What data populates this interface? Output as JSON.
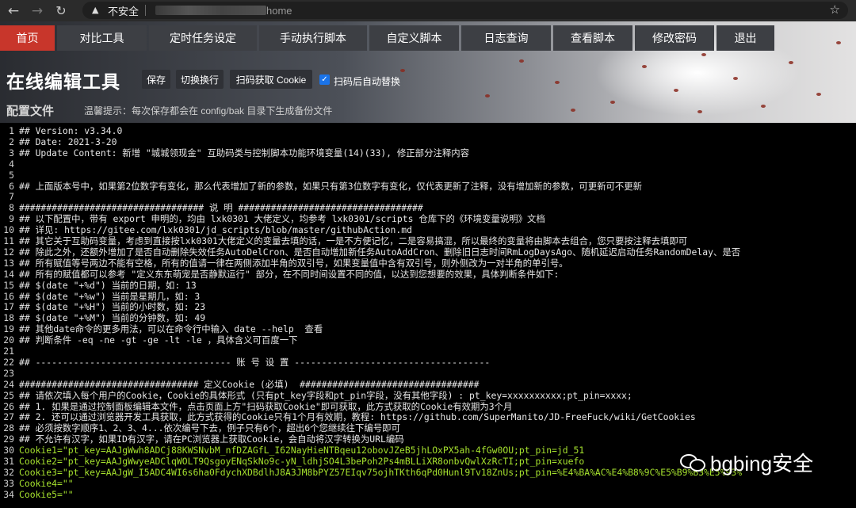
{
  "browser": {
    "security_label": "不安全",
    "url_path": "home"
  },
  "nav": {
    "tabs": [
      {
        "label": "首页",
        "active": true
      },
      {
        "label": "对比工具"
      },
      {
        "label": "定时任务设定"
      },
      {
        "label": "手动执行脚本"
      },
      {
        "label": "自定义脚本"
      },
      {
        "label": "日志查询"
      },
      {
        "label": "查看脚本"
      },
      {
        "label": "修改密码"
      },
      {
        "label": "退出"
      }
    ]
  },
  "toolbar": {
    "title": "在线编辑工具",
    "save": "保存",
    "wrap": "切换换行",
    "scan": "扫码获取 Cookie",
    "auto_replace_label": "扫码后自动替换",
    "auto_replace_checked": true
  },
  "section": {
    "heading": "配置文件",
    "tip": "温馨提示：每次保存都会在 config/bak 目录下生成备份文件"
  },
  "editor": {
    "lines": [
      {
        "n": "1",
        "text": "## Version: v3.34.0"
      },
      {
        "n": "2",
        "text": "## Date: 2021-3-20"
      },
      {
        "n": "3",
        "text": "## Update Content: 新增 \"城城领现金\" 互助码类与控制脚本功能环境变量(14)(33), 修正部分注释内容"
      },
      {
        "n": "4",
        "text": ""
      },
      {
        "n": "5",
        "text": ""
      },
      {
        "n": "6",
        "text": "## 上面版本号中，如果第2位数字有变化，那么代表增加了新的参数，如果只有第3位数字有变化，仅代表更新了注释，没有增加新的参数，可更新可不更新"
      },
      {
        "n": "7",
        "text": ""
      },
      {
        "n": "8",
        "text": "################################## 说 明 ##################################"
      },
      {
        "n": "9",
        "text": "## 以下配置中，带有 export 申明的，均由 lxk0301 大佬定义，均参考 lxk0301/scripts 仓库下的《环境变量说明》文档"
      },
      {
        "n": "10",
        "text": "## 详见: https://gitee.com/lxk0301/jd_scripts/blob/master/githubAction.md"
      },
      {
        "n": "11",
        "text": "## 其它关于互助码变量，考虑到直接按lxk0301大佬定义的变量去填的话，一是不方便记忆，二是容易搞混，所以最终的变量将由脚本去组合，您只要按注释去填即可"
      },
      {
        "n": "12",
        "text": "## 除此之外，还额外增加了是否自动删除失效任务AutoDelCron、是否自动增加新任务AutoAddCron、删除旧日志时间RmLogDaysAgo、随机延迟启动任务RandomDelay、是否"
      },
      {
        "n": "13",
        "text": "## 所有赋值等号两边不能有空格，所有的值请一律在两侧添加半角的双引号，如果变量值中含有双引号，则外侧改为一对半角的单引号。"
      },
      {
        "n": "14",
        "text": "## 所有的赋值都可以参考 \"定义东东萌宠是否静默运行\" 部分，在不同时间设置不同的值，以达到您想要的效果，具体判断条件如下:"
      },
      {
        "n": "15",
        "text": "## $(date \"+%d\") 当前的日期，如: 13"
      },
      {
        "n": "16",
        "text": "## $(date \"+%w\") 当前是星期几，如: 3"
      },
      {
        "n": "17",
        "text": "## $(date \"+%H\") 当前的小时数，如: 23"
      },
      {
        "n": "18",
        "text": "## $(date \"+%M\") 当前的分钟数，如: 49"
      },
      {
        "n": "19",
        "text": "## 其他date命令的更多用法，可以在命令行中输入 date --help  查看"
      },
      {
        "n": "20",
        "text": "## 判断条件 -eq -ne -gt -ge -lt -le ，具体含义可百度一下"
      },
      {
        "n": "21",
        "text": ""
      },
      {
        "n": "22",
        "text": "## ------------------------------------ 账 号 设 置 ------------------------------------"
      },
      {
        "n": "23",
        "text": ""
      },
      {
        "n": "24",
        "text": "################################# 定义Cookie (必填)  #################################"
      },
      {
        "n": "25",
        "text": "## 请依次填入每个用户的Cookie，Cookie的具体形式 (只有pt_key字段和pt_pin字段，没有其他字段) : pt_key=xxxxxxxxxx;pt_pin=xxxx;"
      },
      {
        "n": "26",
        "text": "## 1. 如果是通过控制面板编辑本文件，点击页面上方\"扫码获取Cookie\"即可获取，此方式获取的Cookie有效期为3个月"
      },
      {
        "n": "27",
        "text": "## 2. 还可以通过浏览器开发工具获取，此方式获得的Cookie只有1个月有效期，教程: https://github.com/SuperManito/JD-FreeFuck/wiki/GetCookies"
      },
      {
        "n": "28",
        "text": "## 必须按数字顺序1、2、3、4...依次编号下去，例子只有6个，超出6个您继续往下编号即可"
      },
      {
        "n": "29",
        "text": "## 不允许有汉字，如果ID有汉字，请在PC浏览器上获取Cookie，会自动将汉字转换为URL编码"
      },
      {
        "n": "30",
        "text": "Cookie1=\"pt_key=AAJgWwh8ADCj88KWSNvbM_nfDZAGfL_I62NayHieNTBqeu12obovJZeB5jhLOxPX5ah-4fGw0OU;pt_pin=jd_51",
        "str": true
      },
      {
        "n": "31",
        "text": "Cookie2=\"pt_key=AAJgWwyeADClqWOLT9QsgoyENqSkNo9c-yN_ldhjSO4L3bePoh2Ps4mBLLiXR8onbvQwlXzRcTI;pt_pin=xuefo",
        "str": true
      },
      {
        "n": "32",
        "text": "Cookie3=\"pt_key=AAJgW_I5ADC4WI6s6ha0FdychXDBdlhJ8A3JM8bPYZ57EIqv75ojhTKth6qPd0Hunl9Tv18ZnUs;pt_pin=%E4%BA%AC%E4%B8%9C%E5%B9%B3%E5%93%",
        "str": true
      },
      {
        "n": "33",
        "text": "Cookie4=\"\"",
        "str": true
      },
      {
        "n": "34",
        "text": "Cookie5=\"\"",
        "str": true
      }
    ]
  },
  "watermark": {
    "text": "bgbing安全"
  }
}
